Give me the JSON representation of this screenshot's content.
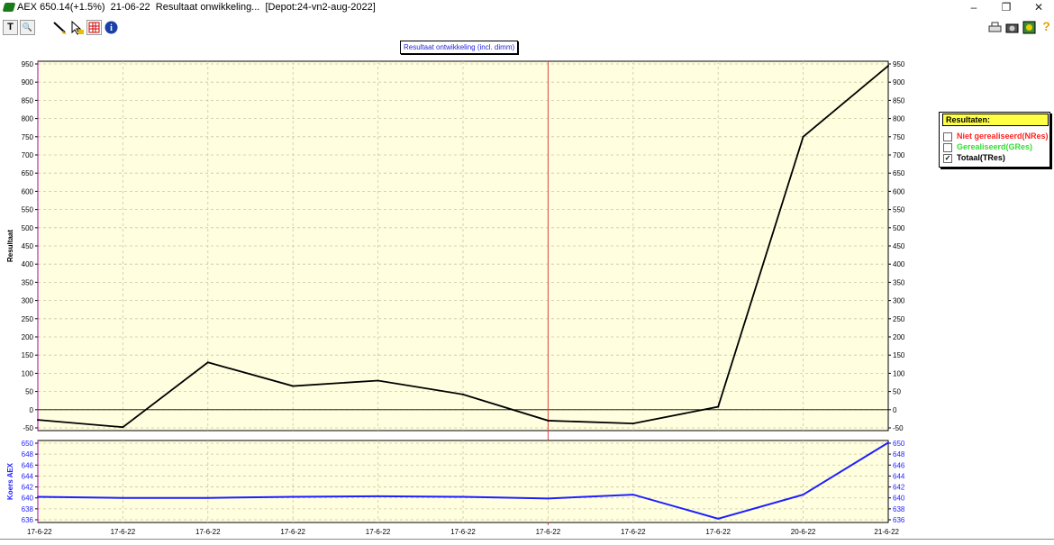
{
  "window": {
    "title": "AEX 650.14(+1.5%)  21-06-22  Resultaat onwikkeling...  [Depot:24-vn2-aug-2022]",
    "minimize": "–",
    "restore": "❐",
    "close": "✕"
  },
  "toolbar": {
    "text_tool": "T",
    "zoom_tool": "🔍",
    "info": "i"
  },
  "chart_title": "Resultaat ontwikkeling (incl. dimm)",
  "legend": {
    "header": "Resultaten:",
    "items": [
      {
        "label": "Niet gerealiseerd(NRes)",
        "color": "#ff2222",
        "checked": false
      },
      {
        "label": "Gerealiseerd(GRes)",
        "color": "#33dd33",
        "checked": false
      },
      {
        "label": "Totaal(TRes)",
        "color": "#000000",
        "checked": true
      }
    ]
  },
  "chart_data": [
    {
      "type": "line",
      "ylabel": "Resultaat",
      "ylim": [
        -50,
        950
      ],
      "yticks": [
        -50,
        0,
        50,
        100,
        150,
        200,
        250,
        300,
        350,
        400,
        450,
        500,
        550,
        600,
        650,
        700,
        750,
        800,
        850,
        900,
        950
      ],
      "ytick_labels": [
        "-50",
        "0",
        "50",
        "100",
        "150",
        "200",
        "250",
        "300",
        "350",
        "400",
        "450",
        "500",
        "550",
        "600",
        "650",
        "700",
        "750",
        "800",
        "850",
        "900",
        "950"
      ],
      "x": [
        "17-6-22",
        "17-6-22",
        "17-6-22",
        "17-6-22",
        "17-6-22",
        "17-6-22",
        "17-6-22",
        "17-6-22",
        "17-6-22",
        "20-6-22",
        "21-6-22"
      ],
      "series": [
        {
          "name": "Totaal(TRes)",
          "color": "#000000",
          "values": [
            -28,
            -48,
            130,
            65,
            80,
            42,
            -30,
            -38,
            8,
            750,
            945
          ]
        }
      ],
      "vertical_marker_index": 6,
      "background": "#ffffe0",
      "grid": true
    },
    {
      "type": "line",
      "ylabel": "Koers AEX",
      "ylim": [
        636,
        650
      ],
      "yticks": [
        636,
        638,
        640,
        642,
        644,
        646,
        648,
        650
      ],
      "ytick_labels": [
        "636",
        "638",
        "640",
        "642",
        "644",
        "646",
        "648",
        "650"
      ],
      "x": [
        "17-6-22",
        "17-6-22",
        "17-6-22",
        "17-6-22",
        "17-6-22",
        "17-6-22",
        "17-6-22",
        "17-6-22",
        "17-6-22",
        "20-6-22",
        "21-6-22"
      ],
      "x_labels": [
        "17-6-22",
        "17-6-22",
        "17-6-22",
        "17-6-22",
        "17-6-22",
        "17-6-22",
        "17-6-22",
        "17-6-22",
        "17-6-22",
        "20-6-22",
        "21-6-22"
      ],
      "series": [
        {
          "color": "#1f1fff",
          "values": [
            640.2,
            640.0,
            640.0,
            640.2,
            640.3,
            640.2,
            639.9,
            640.6,
            636.2,
            640.6,
            650.1
          ]
        }
      ],
      "background": "#ffffe0",
      "grid": true
    }
  ]
}
